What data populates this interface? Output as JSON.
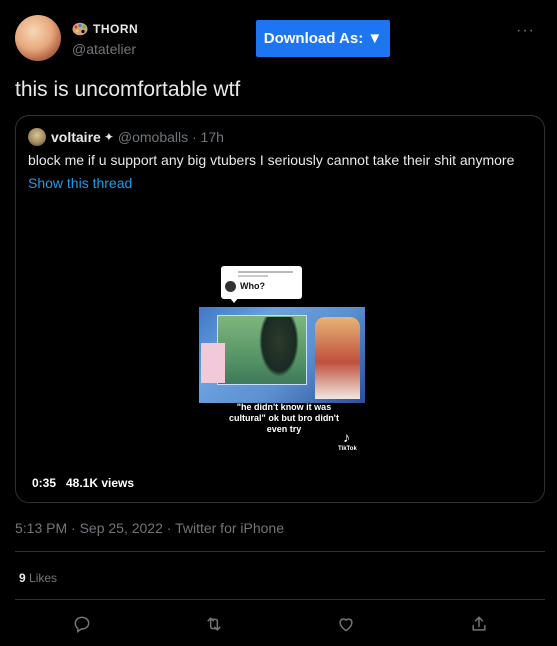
{
  "author": {
    "display_name": "THORN",
    "handle": "@atatelier",
    "palette_icon": "palette-icon",
    "avatar_icon": "avatar"
  },
  "download_button": {
    "label": "Download As: ▼"
  },
  "more_icon": "···",
  "tweet": {
    "text": "this is uncomfortable wtf",
    "timestamp": "5:13 PM · Sep 25, 2022 · Twitter for iPhone",
    "likes_count": "9",
    "likes_label": " Likes"
  },
  "quoted": {
    "name": "voltaire",
    "verified_icon": "✦",
    "handle": "@omoballs · 17h",
    "text": "block me if u support any big vtubers I seriously cannot take their shit anymore",
    "show_thread": "Show this thread",
    "video": {
      "reply_bubble_text": "Who?",
      "caption": "\"he didn't know it was cultural\" ok but bro didn't even try",
      "tiktok_icon": "♪",
      "tiktok_label": "TikTok",
      "duration": "0:35",
      "views": "48.1K views"
    }
  },
  "actions": {
    "reply_icon": "reply-icon",
    "retweet_icon": "retweet-icon",
    "like_icon": "heart-icon",
    "share_icon": "share-icon"
  }
}
